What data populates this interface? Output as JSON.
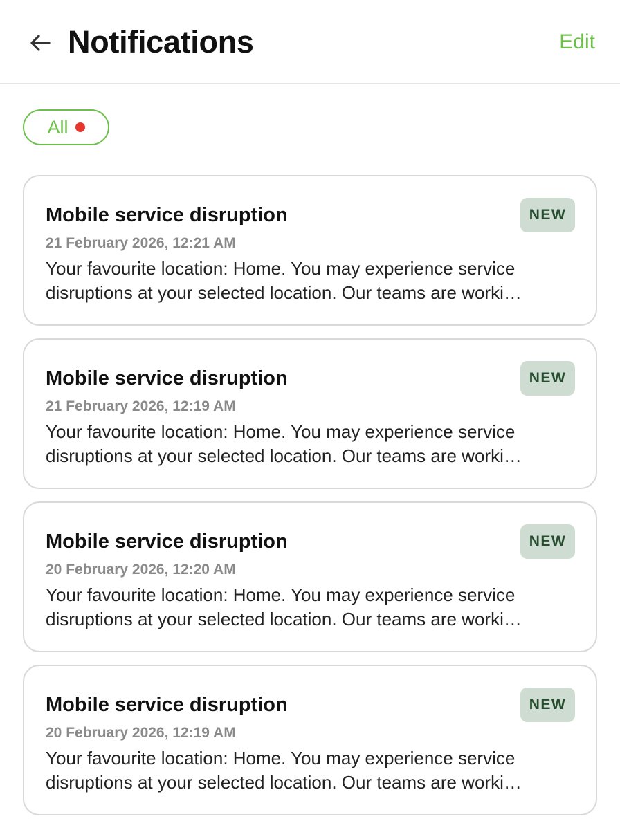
{
  "colors": {
    "accent": "#6cc04a",
    "unread_dot": "#e8362d",
    "badge_bg": "#cfdcd2",
    "badge_text": "#264d2f"
  },
  "header": {
    "back_icon": "arrow-left-icon",
    "title": "Notifications",
    "edit_label": "Edit"
  },
  "filter": {
    "label": "All",
    "indicator": "unread-dot"
  },
  "notifications": [
    {
      "title": "Mobile service disruption",
      "date": "21 February 2026, 12:21 AM",
      "body_line1": "Your favourite location: Home. You may experience service",
      "body_line2": "disruptions at your selected location. Our teams are worki…",
      "badge": "NEW"
    },
    {
      "title": "Mobile service disruption",
      "date": "21 February 2026, 12:19 AM",
      "body_line1": "Your favourite location: Home. You may experience service",
      "body_line2": "disruptions at your selected location. Our teams are worki…",
      "badge": "NEW"
    },
    {
      "title": "Mobile service disruption",
      "date": "20 February 2026, 12:20 AM",
      "body_line1": "Your favourite location: Home. You may experience service",
      "body_line2": "disruptions at your selected location. Our teams are worki…",
      "badge": "NEW"
    },
    {
      "title": "Mobile service disruption",
      "date": "20 February 2026, 12:19 AM",
      "body_line1": "Your favourite location: Home. You may experience service",
      "body_line2": "disruptions at your selected location. Our teams are worki…",
      "badge": "NEW"
    }
  ]
}
